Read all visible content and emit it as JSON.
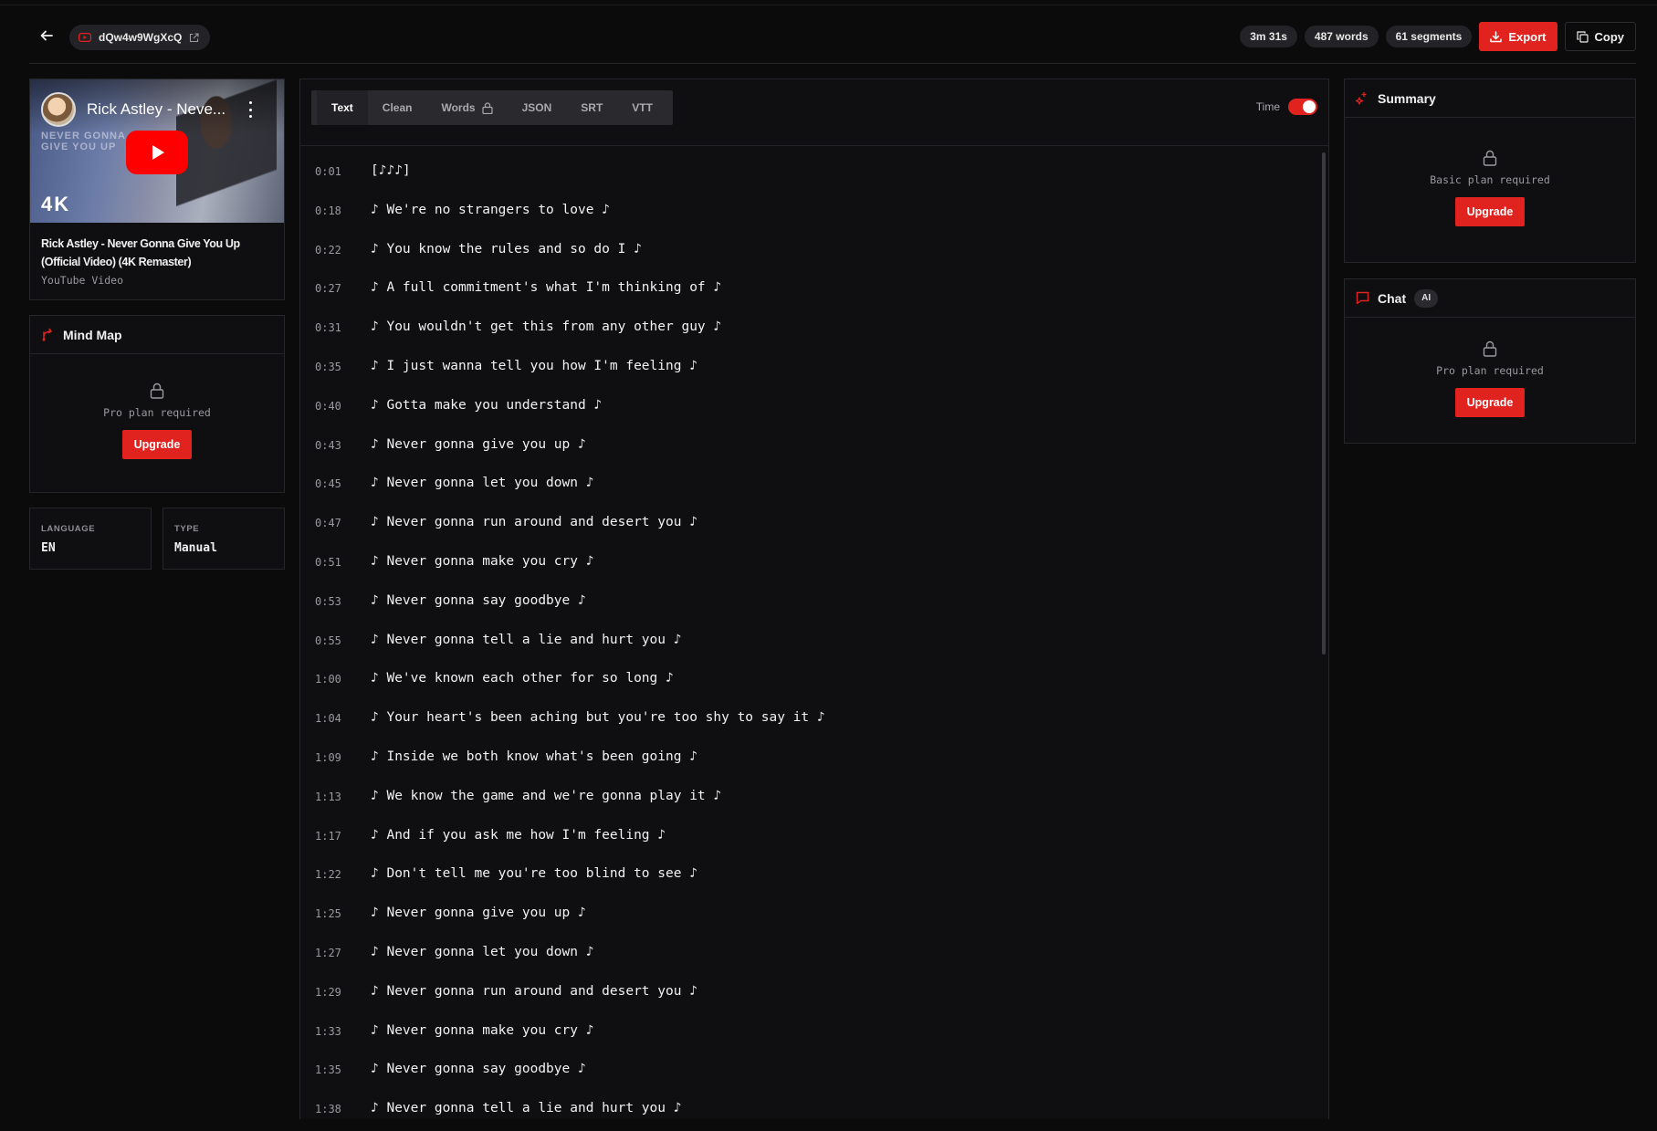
{
  "header": {
    "video_id": "dQw4w9WgXcQ",
    "stats": {
      "duration": "3m 31s",
      "words": "487 words",
      "segments": "61 segments"
    },
    "export_label": "Export",
    "copy_label": "Copy"
  },
  "video": {
    "thumb_title": "Rick Astley - Neve...",
    "thumb_badge": "4K",
    "thumb_overlay": "NEVER GONNA GIVE YOU UP",
    "title": "Rick Astley - Never Gonna Give You Up (Official Video) (4K Remaster)",
    "subtitle": "YouTube Video"
  },
  "mind_map": {
    "title": "Mind Map",
    "message": "Pro plan required",
    "button": "Upgrade"
  },
  "meta": {
    "language_label": "LANGUAGE",
    "language_value": "EN",
    "type_label": "TYPE",
    "type_value": "Manual"
  },
  "tabs": [
    {
      "label": "Text",
      "active": true
    },
    {
      "label": "Clean",
      "active": false
    },
    {
      "label": "Words",
      "active": false,
      "locked": true
    },
    {
      "label": "JSON",
      "active": false
    },
    {
      "label": "SRT",
      "active": false
    },
    {
      "label": "VTT",
      "active": false
    }
  ],
  "time_toggle": {
    "label": "Time",
    "on": true
  },
  "transcript": [
    {
      "t": "0:01",
      "text": "[♪♪♪]"
    },
    {
      "t": "0:18",
      "text": "♪ We're no strangers to love ♪"
    },
    {
      "t": "0:22",
      "text": "♪ You know the rules and so do I ♪"
    },
    {
      "t": "0:27",
      "text": "♪ A full commitment's what I'm thinking of ♪"
    },
    {
      "t": "0:31",
      "text": "♪ You wouldn't get this from any other guy ♪"
    },
    {
      "t": "0:35",
      "text": "♪ I just wanna tell you how I'm feeling ♪"
    },
    {
      "t": "0:40",
      "text": "♪ Gotta make you understand ♪"
    },
    {
      "t": "0:43",
      "text": "♪ Never gonna give you up ♪"
    },
    {
      "t": "0:45",
      "text": "♪ Never gonna let you down ♪"
    },
    {
      "t": "0:47",
      "text": "♪ Never gonna run around and desert you ♪"
    },
    {
      "t": "0:51",
      "text": "♪ Never gonna make you cry ♪"
    },
    {
      "t": "0:53",
      "text": "♪ Never gonna say goodbye ♪"
    },
    {
      "t": "0:55",
      "text": "♪ Never gonna tell a lie and hurt you ♪"
    },
    {
      "t": "1:00",
      "text": "♪ We've known each other for so long ♪"
    },
    {
      "t": "1:04",
      "text": "♪ Your heart's been aching but you're too shy to say it ♪"
    },
    {
      "t": "1:09",
      "text": "♪ Inside we both know what's been going ♪"
    },
    {
      "t": "1:13",
      "text": "♪ We know the game and we're gonna play it ♪"
    },
    {
      "t": "1:17",
      "text": "♪ And if you ask me how I'm feeling ♪"
    },
    {
      "t": "1:22",
      "text": "♪ Don't tell me you're too blind to see ♪"
    },
    {
      "t": "1:25",
      "text": "♪ Never gonna give you up ♪"
    },
    {
      "t": "1:27",
      "text": "♪ Never gonna let you down ♪"
    },
    {
      "t": "1:29",
      "text": "♪ Never gonna run around and desert you ♪"
    },
    {
      "t": "1:33",
      "text": "♪ Never gonna make you cry ♪"
    },
    {
      "t": "1:35",
      "text": "♪ Never gonna say goodbye ♪"
    },
    {
      "t": "1:38",
      "text": "♪ Never gonna tell a lie and hurt you ♪"
    }
  ],
  "summary": {
    "title": "Summary",
    "message": "Basic plan required",
    "button": "Upgrade"
  },
  "chat": {
    "title": "Chat",
    "badge": "AI",
    "message": "Pro plan required",
    "button": "Upgrade"
  },
  "colors": {
    "accent": "#e0231f",
    "background": "#0b0b0c",
    "panel": "#0f0f11"
  }
}
